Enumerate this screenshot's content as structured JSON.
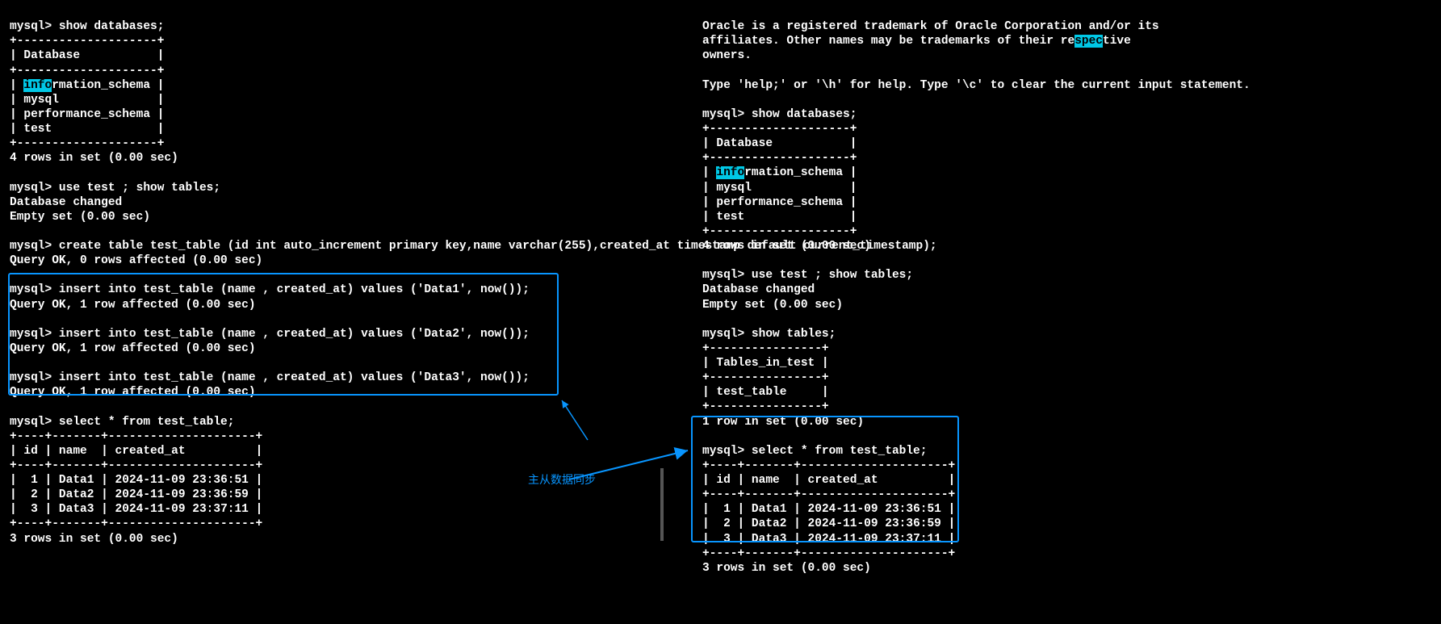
{
  "colors": {
    "highlight_bg": "#00c8e6",
    "box_border": "#0895ff"
  },
  "annotation": {
    "label": "主从数据同步"
  },
  "left": {
    "prompt": "mysql>",
    "cmds": {
      "show_db": "show databases;",
      "use_test": "use test ; show tables;",
      "create_table": "create table test_table (id int auto_increment primary key,name varchar(255),created_at timestamp default current_timestamp);",
      "insert1": "insert into test_table (name , created_at) values ('Data1', now());",
      "insert2": "insert into test_table (name , created_at) values ('Data2', now());",
      "insert3": "insert into test_table (name , created_at) values ('Data3', now());",
      "select": "select * from test_table;"
    },
    "msgs": {
      "db_changed": "Database changed",
      "empty_set": "Empty set (0.00 sec)",
      "q_ok0": "Query OK, 0 rows affected (0.00 sec)",
      "q_ok1": "Query OK, 1 row affected (0.00 sec)",
      "rows4": "4 rows in set (0.00 sec)",
      "rows3": "3 rows in set (0.00 sec)"
    },
    "databases": {
      "header": "Database",
      "hl_part": "info",
      "row1_rest": "rmation_schema",
      "rows": [
        "mysql",
        "performance_schema",
        "test"
      ]
    },
    "select_result": {
      "cols": [
        "id",
        "name",
        "created_at"
      ],
      "rows": [
        {
          "id": "1",
          "name": "Data1",
          "ts": "2024-11-09 23:36:51"
        },
        {
          "id": "2",
          "name": "Data2",
          "ts": "2024-11-09 23:36:59"
        },
        {
          "id": "3",
          "name": "Data3",
          "ts": "2024-11-09 23:37:11"
        }
      ]
    }
  },
  "right": {
    "banner_l1_a": "Oracle is a registered trademark of Oracle Corporation and/or its",
    "banner_l2_pre": "affiliates. Other names may be trademarks of their re",
    "banner_l2_hl": "spec",
    "banner_l2_post": "tive",
    "banner_l3": "owners.",
    "help": "Type 'help;' or '\\h' for help. Type '\\c' to clear the current input statement.",
    "prompt": "mysql>",
    "cmds": {
      "show_db": "show databases;",
      "use_test": "use test ; show tables;",
      "show_tables": "show tables;",
      "select": "select * from test_table;"
    },
    "msgs": {
      "db_changed": "Database changed",
      "empty_set": "Empty set (0.00 sec)",
      "rows4": "4 rows in set (0.00 sec)",
      "rows1": "1 row in set (0.00 sec)",
      "rows3": "3 rows in set (0.00 sec)"
    },
    "databases": {
      "header": "Database",
      "hl_part": "info",
      "row1_rest": "rmation_schema",
      "rows": [
        "mysql",
        "performance_schema",
        "test"
      ]
    },
    "tables": {
      "header": "Tables_in_test",
      "rows": [
        "test_table"
      ]
    },
    "select_result": {
      "cols": [
        "id",
        "name",
        "created_at"
      ],
      "rows": [
        {
          "id": "1",
          "name": "Data1",
          "ts": "2024-11-09 23:36:51"
        },
        {
          "id": "2",
          "name": "Data2",
          "ts": "2024-11-09 23:36:59"
        },
        {
          "id": "3",
          "name": "Data3",
          "ts": "2024-11-09 23:37:11"
        }
      ]
    }
  }
}
